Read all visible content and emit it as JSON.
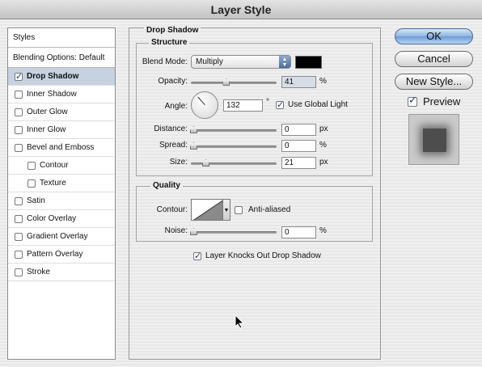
{
  "window": {
    "title": "Layer Style"
  },
  "styles_panel": {
    "header": "Styles",
    "blending_options": "Blending Options: Default",
    "items": [
      {
        "label": "Drop Shadow",
        "checked": true,
        "selected": true,
        "sub": false
      },
      {
        "label": "Inner Shadow",
        "checked": false,
        "selected": false,
        "sub": false
      },
      {
        "label": "Outer Glow",
        "checked": false,
        "selected": false,
        "sub": false
      },
      {
        "label": "Inner Glow",
        "checked": false,
        "selected": false,
        "sub": false
      },
      {
        "label": "Bevel and Emboss",
        "checked": false,
        "selected": false,
        "sub": false
      },
      {
        "label": "Contour",
        "checked": false,
        "selected": false,
        "sub": true
      },
      {
        "label": "Texture",
        "checked": false,
        "selected": false,
        "sub": true
      },
      {
        "label": "Satin",
        "checked": false,
        "selected": false,
        "sub": false
      },
      {
        "label": "Color Overlay",
        "checked": false,
        "selected": false,
        "sub": false
      },
      {
        "label": "Gradient Overlay",
        "checked": false,
        "selected": false,
        "sub": false
      },
      {
        "label": "Pattern Overlay",
        "checked": false,
        "selected": false,
        "sub": false
      },
      {
        "label": "Stroke",
        "checked": false,
        "selected": false,
        "sub": false
      }
    ]
  },
  "drop_shadow": {
    "title": "Drop Shadow",
    "structure": {
      "legend": "Structure",
      "blend_mode_label": "Blend Mode:",
      "blend_mode_value": "Multiply",
      "shadow_color": "#000000",
      "opacity_label": "Opacity:",
      "opacity_value": "41",
      "opacity_unit": "%",
      "opacity_fraction": 0.41,
      "angle_label": "Angle:",
      "angle_value": "132",
      "angle_unit": "°",
      "use_global_light_label": "Use Global Light",
      "use_global_light_checked": true,
      "distance_label": "Distance:",
      "distance_value": "0",
      "distance_unit": "px",
      "spread_label": "Spread:",
      "spread_value": "0",
      "spread_unit": "%",
      "size_label": "Size:",
      "size_value": "21",
      "size_unit": "px"
    },
    "quality": {
      "legend": "Quality",
      "contour_label": "Contour:",
      "anti_aliased_label": "Anti-aliased",
      "anti_aliased_checked": false,
      "noise_label": "Noise:",
      "noise_value": "0",
      "noise_unit": "%"
    },
    "knockout_label": "Layer Knocks Out Drop Shadow",
    "knockout_checked": true
  },
  "buttons": {
    "ok": "OK",
    "cancel": "Cancel",
    "new_style": "New Style...",
    "preview_label": "Preview",
    "preview_checked": true
  }
}
